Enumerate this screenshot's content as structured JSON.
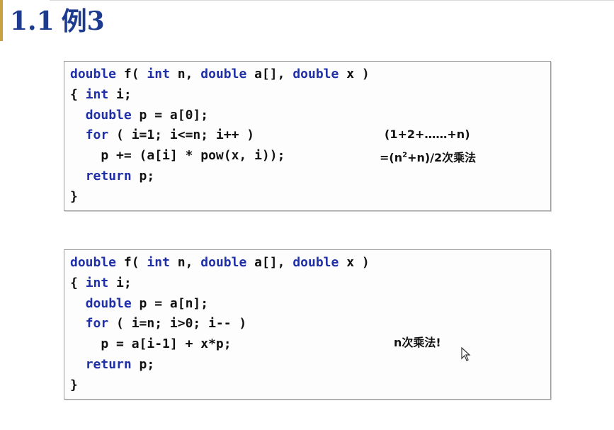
{
  "title": {
    "number": "1.1",
    "text": "例3"
  },
  "code_blocks": [
    {
      "lines": [
        {
          "indent": "",
          "tokens": [
            {
              "t": "double",
              "kw": true
            },
            {
              "t": " f( "
            },
            {
              "t": "int",
              "kw": true
            },
            {
              "t": " n, "
            },
            {
              "t": "double",
              "kw": true
            },
            {
              "t": " a[], "
            },
            {
              "t": "double",
              "kw": true
            },
            {
              "t": " x )"
            }
          ]
        },
        {
          "indent": "",
          "tokens": [
            {
              "t": "{ "
            },
            {
              "t": "int",
              "kw": true
            },
            {
              "t": " i;"
            }
          ]
        },
        {
          "indent": "  ",
          "tokens": [
            {
              "t": "double",
              "kw": true
            },
            {
              "t": " p = a[0];"
            }
          ]
        },
        {
          "indent": "  ",
          "tokens": [
            {
              "t": "for",
              "kw": true
            },
            {
              "t": " ( i=1; i<=n; i++ )"
            }
          ]
        },
        {
          "indent": "    ",
          "tokens": [
            {
              "t": "p += (a[i] * pow(x, i));"
            }
          ]
        },
        {
          "indent": "  ",
          "tokens": [
            {
              "t": "return",
              "kw": true
            },
            {
              "t": " p;"
            }
          ]
        },
        {
          "indent": "",
          "tokens": [
            {
              "t": "}"
            }
          ]
        }
      ],
      "annotation_line1": "(1+2+……+n)",
      "annotation_line2_pre": "=(n",
      "annotation_line2_sup": "2",
      "annotation_line2_post": "+n)/2次乘法"
    },
    {
      "lines": [
        {
          "indent": "",
          "tokens": [
            {
              "t": "double",
              "kw": true
            },
            {
              "t": " f( "
            },
            {
              "t": "int",
              "kw": true
            },
            {
              "t": " n, "
            },
            {
              "t": "double",
              "kw": true
            },
            {
              "t": " a[], "
            },
            {
              "t": "double",
              "kw": true
            },
            {
              "t": " x )"
            }
          ]
        },
        {
          "indent": "",
          "tokens": [
            {
              "t": "{ "
            },
            {
              "t": "int",
              "kw": true
            },
            {
              "t": " i;"
            }
          ]
        },
        {
          "indent": "  ",
          "tokens": [
            {
              "t": "double",
              "kw": true
            },
            {
              "t": " p = a[n];"
            }
          ]
        },
        {
          "indent": "  ",
          "tokens": [
            {
              "t": "for",
              "kw": true
            },
            {
              "t": " ( i=n; i>0; i-- )"
            }
          ]
        },
        {
          "indent": "    ",
          "tokens": [
            {
              "t": "p = a[i-1] + x*p;"
            }
          ]
        },
        {
          "indent": "  ",
          "tokens": [
            {
              "t": "return",
              "kw": true
            },
            {
              "t": " p;"
            }
          ]
        },
        {
          "indent": "",
          "tokens": [
            {
              "t": "}"
            }
          ]
        }
      ],
      "annotation": "n次乘法!"
    }
  ],
  "colors": {
    "title": "#1d3b8f",
    "keyword": "#1f2fa8",
    "text": "#111111",
    "accent": "#c9a040"
  },
  "icons": {
    "cursor": "mouse-pointer-icon"
  }
}
